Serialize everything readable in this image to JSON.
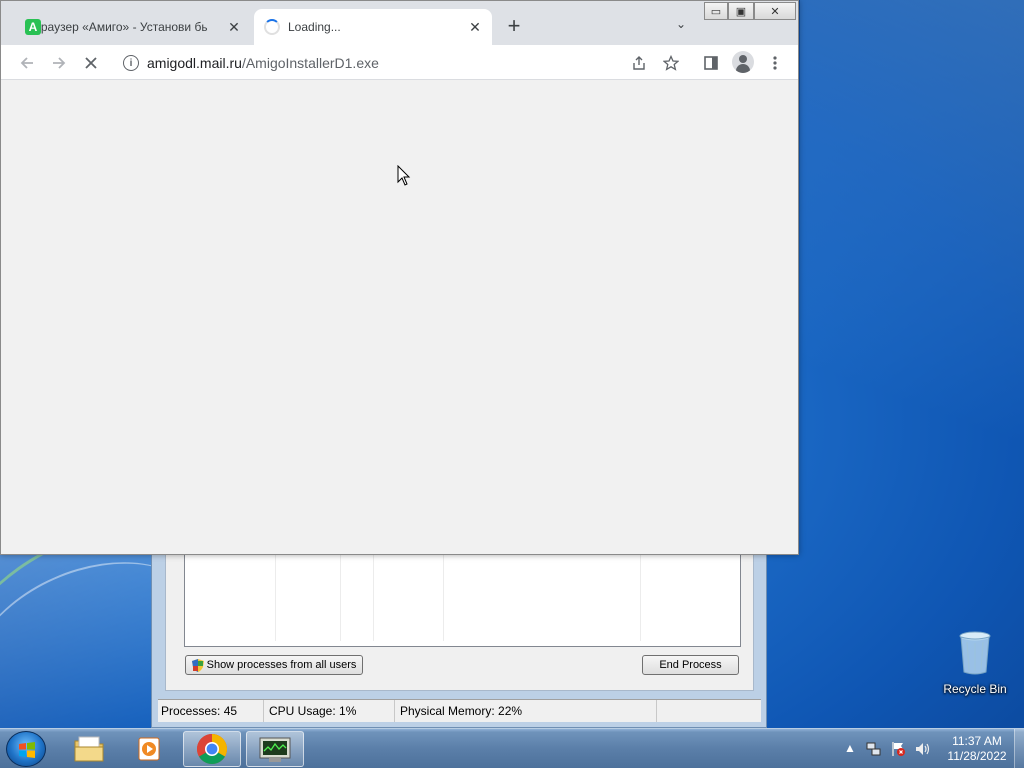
{
  "desktop": {
    "recycle_bin_label": "Recycle Bin"
  },
  "taskmgr": {
    "show_all_label": "Show processes from all users",
    "end_process_label": "End Process",
    "status": {
      "processes": "Processes: 45",
      "cpu": "CPU Usage: 1%",
      "memory": "Physical Memory: 22%"
    }
  },
  "browser": {
    "tabs": [
      {
        "title": "Браузер «Амиго» - Установи бы",
        "favicon": "A",
        "state": "inactive"
      },
      {
        "title": "Loading...",
        "state": "loading"
      }
    ],
    "url_domain": "amigodl.mail.ru",
    "url_path": "/AmigoInstallerD1.exe",
    "window_controls": {
      "minimize": "▭",
      "maximize": "▣",
      "close": "✕"
    }
  },
  "taskbar": {
    "clock_time": "11:37 AM",
    "clock_date": "11/28/2022",
    "apps": [
      "file-explorer",
      "media-player",
      "chrome",
      "task-manager"
    ]
  },
  "colors": {
    "desktop_bg": "#1f6fcb",
    "chrome_frame": "#dee1e6",
    "amigo_green": "#29c154",
    "loading_accent": "#1a73e8"
  }
}
